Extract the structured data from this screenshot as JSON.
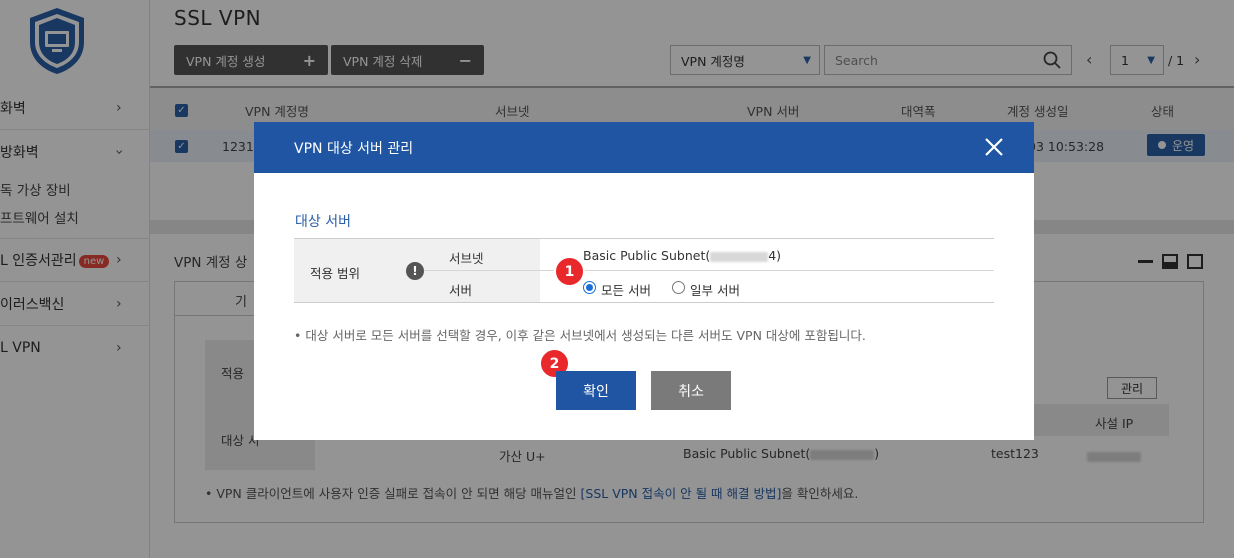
{
  "sidebar": {
    "items": [
      {
        "label": "화벽"
      },
      {
        "label": "방화벽"
      },
      {
        "label": "L 인증서관리"
      },
      {
        "label": "이러스백신"
      },
      {
        "label": "L VPN"
      }
    ],
    "sub_items": [
      "독 가상 장비",
      "프트웨어 설치"
    ],
    "new_badge": "new"
  },
  "header": {
    "title": "SSL VPN",
    "create_label": "VPN 계정 생성",
    "delete_label": "VPN 계정 삭제",
    "filter_select": "VPN 계정명",
    "search_placeholder": "Search",
    "page_current": "1",
    "page_total": "/ 1"
  },
  "table": {
    "columns": [
      "VPN 계정명",
      "서브넷",
      "VPN 서버",
      "대역폭",
      "계정 생성일",
      "상태"
    ],
    "row": {
      "account": "12312",
      "created": "03 10:53:28",
      "status": "운영"
    }
  },
  "detail": {
    "title": "VPN 계정 상",
    "tab_label": "기",
    "scope_label": "적용 ",
    "target_label": "대상 서",
    "manage_label": "관리",
    "private_ip_header": "사설 IP",
    "row": {
      "zone": "가산 U+",
      "subnet": "Basic Public Subnet(",
      "subnet_end": ")",
      "server": "test123"
    },
    "note_prefix": "• VPN 클라이언트에 사용자 인증 실패로 접속이 안 되면 해당 매뉴얼인 ",
    "note_link": "[SSL VPN 접속이 안 될 때 해결 방법]",
    "note_suffix": "을 확인하세요."
  },
  "modal": {
    "title": "VPN 대상 서버 관리",
    "section_title": "대상 서버",
    "scope_label": "적용 범위",
    "subnet_label": "서브넷",
    "subnet_value": "Basic Public Subnet(",
    "subnet_value_end": "4)",
    "server_label": "서버",
    "radio_all": "모든 서버",
    "radio_some": "일부 서버",
    "note": "• 대상 서버로 모든 서버를 선택할 경우, 이후 같은 서브넷에서 생성되는 다른 서버도 VPN 대상에 포함됩니다.",
    "confirm_label": "확인",
    "cancel_label": "취소",
    "step1": "1",
    "step2": "2"
  },
  "colors": {
    "accent": "#1f55a2",
    "danger": "#e8282b",
    "button_dark": "#555555"
  }
}
